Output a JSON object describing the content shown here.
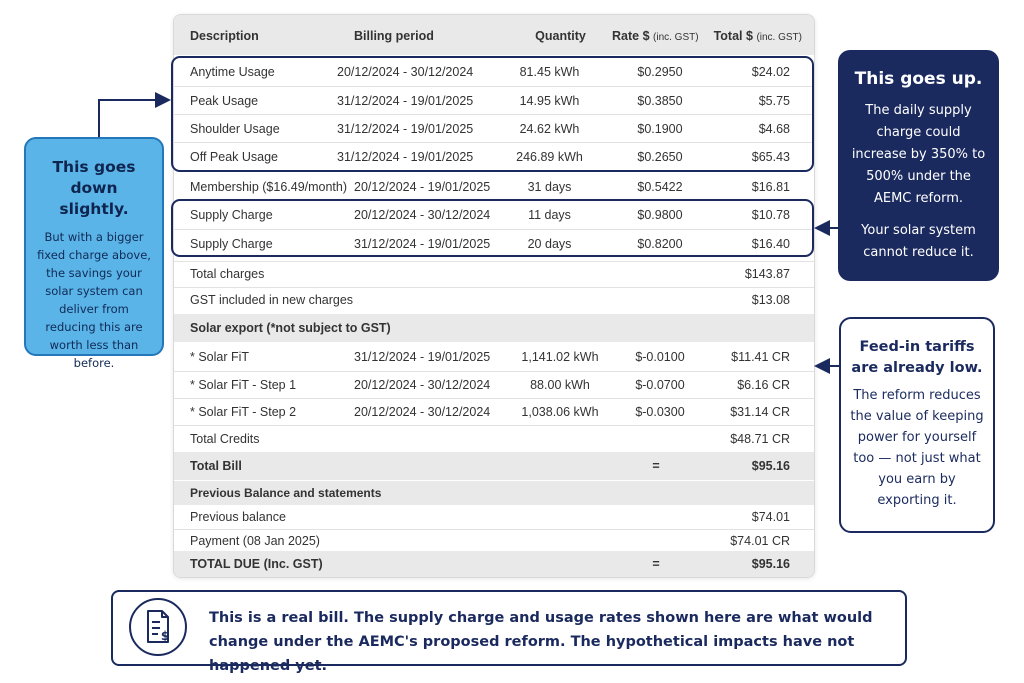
{
  "table": {
    "headers": {
      "description": "Description",
      "period": "Billing period",
      "quantity": "Quantity",
      "rate": "Rate $",
      "rate_note": "(inc. GST)",
      "total": "Total $",
      "total_note": "(inc. GST)"
    },
    "usage_rows": [
      {
        "description": "Anytime Usage",
        "period": "20/12/2024 - 30/12/2024",
        "quantity": "81.45 kWh",
        "rate": "$0.2950",
        "total": "$24.02"
      },
      {
        "description": "Peak Usage",
        "period": "31/12/2024 - 19/01/2025",
        "quantity": "14.95 kWh",
        "rate": "$0.3850",
        "total": "$5.75"
      },
      {
        "description": "Shoulder Usage",
        "period": "31/12/2024 - 19/01/2025",
        "quantity": "24.62 kWh",
        "rate": "$0.1900",
        "total": "$4.68"
      },
      {
        "description": "Off Peak Usage",
        "period": "31/12/2024 - 19/01/2025",
        "quantity": "246.89 kWh",
        "rate": "$0.2650",
        "total": "$65.43"
      }
    ],
    "membership": {
      "description": "Membership ($16.49/month)",
      "period": "20/12/2024 - 19/01/2025",
      "quantity": "31 days",
      "rate": "$0.5422",
      "total": "$16.81"
    },
    "supply_rows": [
      {
        "description": "Supply Charge",
        "period": "20/12/2024 - 30/12/2024",
        "quantity": "11 days",
        "rate": "$0.9800",
        "total": "$10.78"
      },
      {
        "description": "Supply Charge",
        "period": "31/12/2024 - 19/01/2025",
        "quantity": "20 days",
        "rate": "$0.8200",
        "total": "$16.40"
      }
    ],
    "total_charges": {
      "label": "Total charges",
      "total": "$143.87"
    },
    "gst_included": {
      "label": "GST included in new charges",
      "total": "$13.08"
    },
    "solar_header": "Solar export (*not subject to GST)",
    "solar_rows": [
      {
        "description": "* Solar FiT",
        "period": "31/12/2024 - 19/01/2025",
        "quantity": "1,141.02 kWh",
        "rate": "$-0.0100",
        "total": "$11.41 CR"
      },
      {
        "description": "* Solar FiT - Step 1",
        "period": "20/12/2024 - 30/12/2024",
        "quantity": "88.00 kWh",
        "rate": "$-0.0700",
        "total": "$6.16 CR"
      },
      {
        "description": "* Solar FiT - Step 2",
        "period": "20/12/2024 - 30/12/2024",
        "quantity": "1,038.06 kWh",
        "rate": "$-0.0300",
        "total": "$31.14 CR"
      }
    ],
    "total_credits": {
      "label": "Total Credits",
      "total": "$48.71 CR"
    },
    "total_bill": {
      "label": "Total Bill",
      "equals": "=",
      "total": "$95.16"
    },
    "previous_header": "Previous Balance and statements",
    "previous_balance": {
      "label": "Previous balance",
      "total": "$74.01"
    },
    "payment": {
      "label": "Payment (08 Jan 2025)",
      "total": "$74.01 CR"
    },
    "total_due": {
      "label": "TOTAL DUE (Inc. GST)",
      "equals": "=",
      "total": "$95.16"
    }
  },
  "callouts": {
    "left": {
      "title": "This goes down slightly.",
      "body": "But with a bigger fixed charge above, the savings your solar system can deliver from reducing this are worth less than before."
    },
    "up": {
      "title": "This goes up.",
      "body1": "The daily supply charge could increase by 350% to 500% under the AEMC reform.",
      "body2": "Your solar system cannot reduce it."
    },
    "fit": {
      "title": "Feed-in tariffs are already low.",
      "body": "The reform reduces the value of keeping power for yourself too — not just what you earn by exporting it."
    }
  },
  "note": {
    "icon": "document-dollar-icon",
    "text": "This is a real bill. The supply charge and usage rates shown here are what would change under the AEMC's proposed reform. The hypothetical impacts have not happened yet."
  },
  "colors": {
    "navy": "#1b2a5e",
    "light_blue": "#5ab4e8",
    "row_gray": "#e9e9e9"
  }
}
